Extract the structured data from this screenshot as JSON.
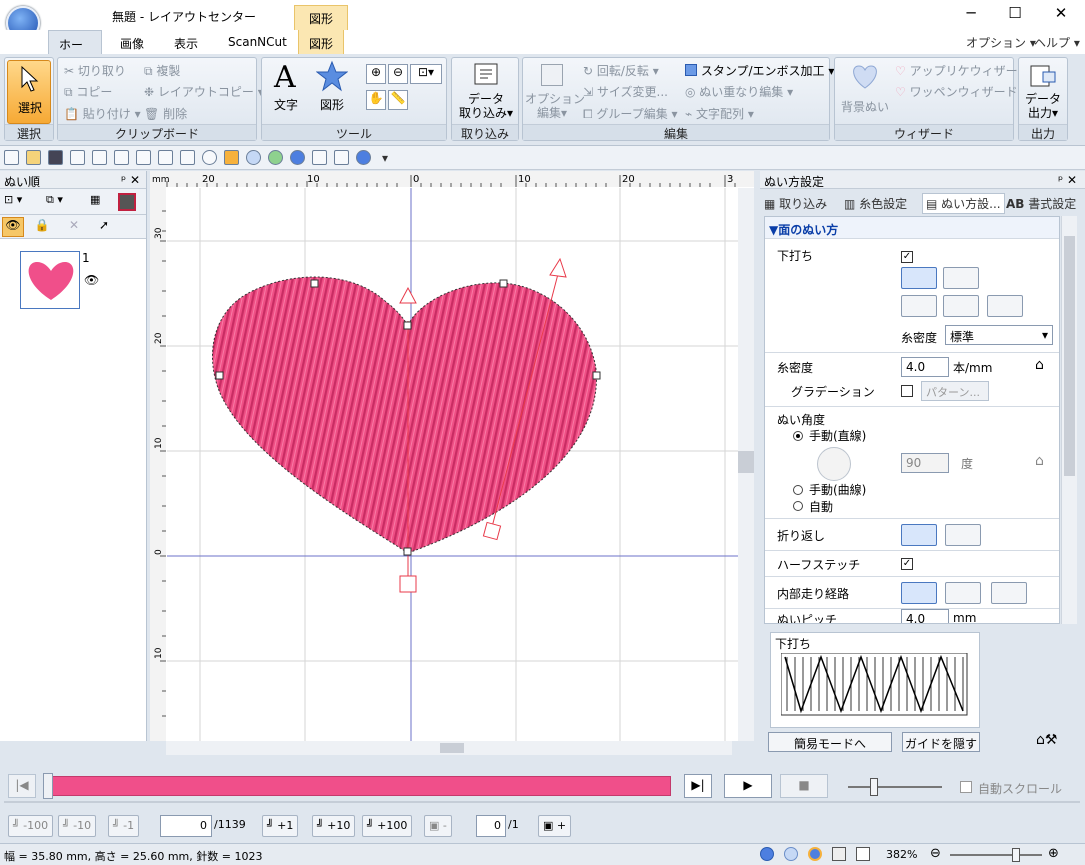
{
  "window": {
    "title": "無題 - レイアウトセンター",
    "context_tab": "図形"
  },
  "tabs": [
    {
      "label": "ホーム"
    },
    {
      "label": "画像"
    },
    {
      "label": "表示"
    },
    {
      "label": "ScanNCut"
    },
    {
      "label": "図形"
    }
  ],
  "menu_right": {
    "options": "オプション",
    "help": "ヘルプ"
  },
  "ribbon": {
    "select": {
      "label": "選択",
      "group": "選択"
    },
    "clipboard": {
      "group": "クリップボード",
      "cut": "切り取り",
      "copy": "コピー",
      "paste": "貼り付け",
      "duplicate": "複製",
      "layout_copy": "レイアウトコピー",
      "delete": "削除"
    },
    "tools": {
      "group": "ツール",
      "text": "文字",
      "shape": "図形"
    },
    "import": {
      "group": "取り込み",
      "data_import": "データ",
      "data_import2": "取り込み"
    },
    "edit": {
      "group": "編集",
      "option_edit": "オプション",
      "option_edit2": "編集",
      "rotate": "回転/反転",
      "size": "サイズ変更...",
      "group_edit": "グループ編集",
      "stamp": "スタンプ/エンボス加工",
      "overlap": "ぬい重なり編集",
      "text_array": "文字配列"
    },
    "wizard": {
      "group": "ウィザード",
      "background": "背景ぬい",
      "applique": "アップリケウィザード",
      "patch": "ワッペンウィザード"
    },
    "output": {
      "group": "出力",
      "data_output": "データ",
      "data_output2": "出力"
    }
  },
  "left_panel": {
    "title": "ぬい順",
    "item_number": "1",
    "heart_color": "#f04f8a"
  },
  "canvas": {
    "unit": "mm",
    "h_ticks": [
      "20",
      "10",
      "0",
      "10",
      "20",
      "3"
    ],
    "v_ticks": [
      "30",
      "20",
      "10",
      "0",
      "10"
    ]
  },
  "right_panel": {
    "title": "ぬい方設定",
    "tabs": [
      {
        "label": "取り込み"
      },
      {
        "label": "糸色設定"
      },
      {
        "label": "ぬい方設..."
      },
      {
        "label": "書式設定"
      }
    ],
    "section": "▼面のぬい方",
    "underlay": {
      "label": "下打ち",
      "checked": "✓",
      "density_label": "糸密度",
      "density_value": "標準"
    },
    "density": {
      "label": "糸密度",
      "value": "4.0",
      "unit": "本/mm"
    },
    "gradation": {
      "label": "グラデーション",
      "pattern": "パターン..."
    },
    "angle": {
      "label": "ぬい角度",
      "manual_line": "手動(直線)",
      "value": "90",
      "unit": "度",
      "manual_curve": "手動(曲線)",
      "auto": "自動"
    },
    "fold": {
      "label": "折り返し"
    },
    "half_stitch": {
      "label": "ハーフステッチ",
      "checked": "✓"
    },
    "inner_path": {
      "label": "内部走り経路"
    },
    "pitch": {
      "label": "ぬいピッチ",
      "value": "4.0",
      "unit": "mm"
    },
    "preview": {
      "label": "下打ち"
    },
    "simple_mode": "簡易モードへ",
    "hide_guide": "ガイドを隠す"
  },
  "player": {
    "auto_scroll": "自動スクロール"
  },
  "stitch_nav": {
    "m100": "-100",
    "m10": "-10",
    "m1": "-1",
    "current": "0",
    "total": "/1139",
    "p1": "+1",
    "p10": "+10",
    "p100": "+100",
    "color_minus": "-",
    "color_current": "0",
    "color_total": "/1",
    "color_plus": "+"
  },
  "status": {
    "info": "幅 = 35.80 mm, 高さ = 25.60 mm, 針数 = 1023",
    "zoom": "382%"
  },
  "colors": {
    "accent": "#f04f8a",
    "ribbon_bg": "#dfe6ee",
    "select_orange": "#f6b13c"
  }
}
